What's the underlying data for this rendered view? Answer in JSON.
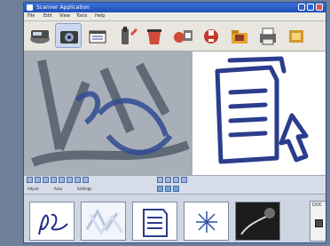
{
  "window": {
    "title": "Scanner Application"
  },
  "menu": [
    "File",
    "Edit",
    "View",
    "Tools",
    "Help"
  ],
  "toolbar": {
    "icons": [
      "scanner",
      "camera",
      "folder-open",
      "tool",
      "delete",
      "settings",
      "help",
      "folder",
      "printer",
      "exit"
    ]
  },
  "controls": {
    "row2_labels": {
      "left": "Adjust",
      "mid": "Auto",
      "right": "Settings"
    }
  },
  "thumbnail_strip": {
    "side_label": "DOC"
  },
  "colors": {
    "accent": "#1f4fb8",
    "ink": "#2b3d8c",
    "background": "#6e7f99"
  }
}
